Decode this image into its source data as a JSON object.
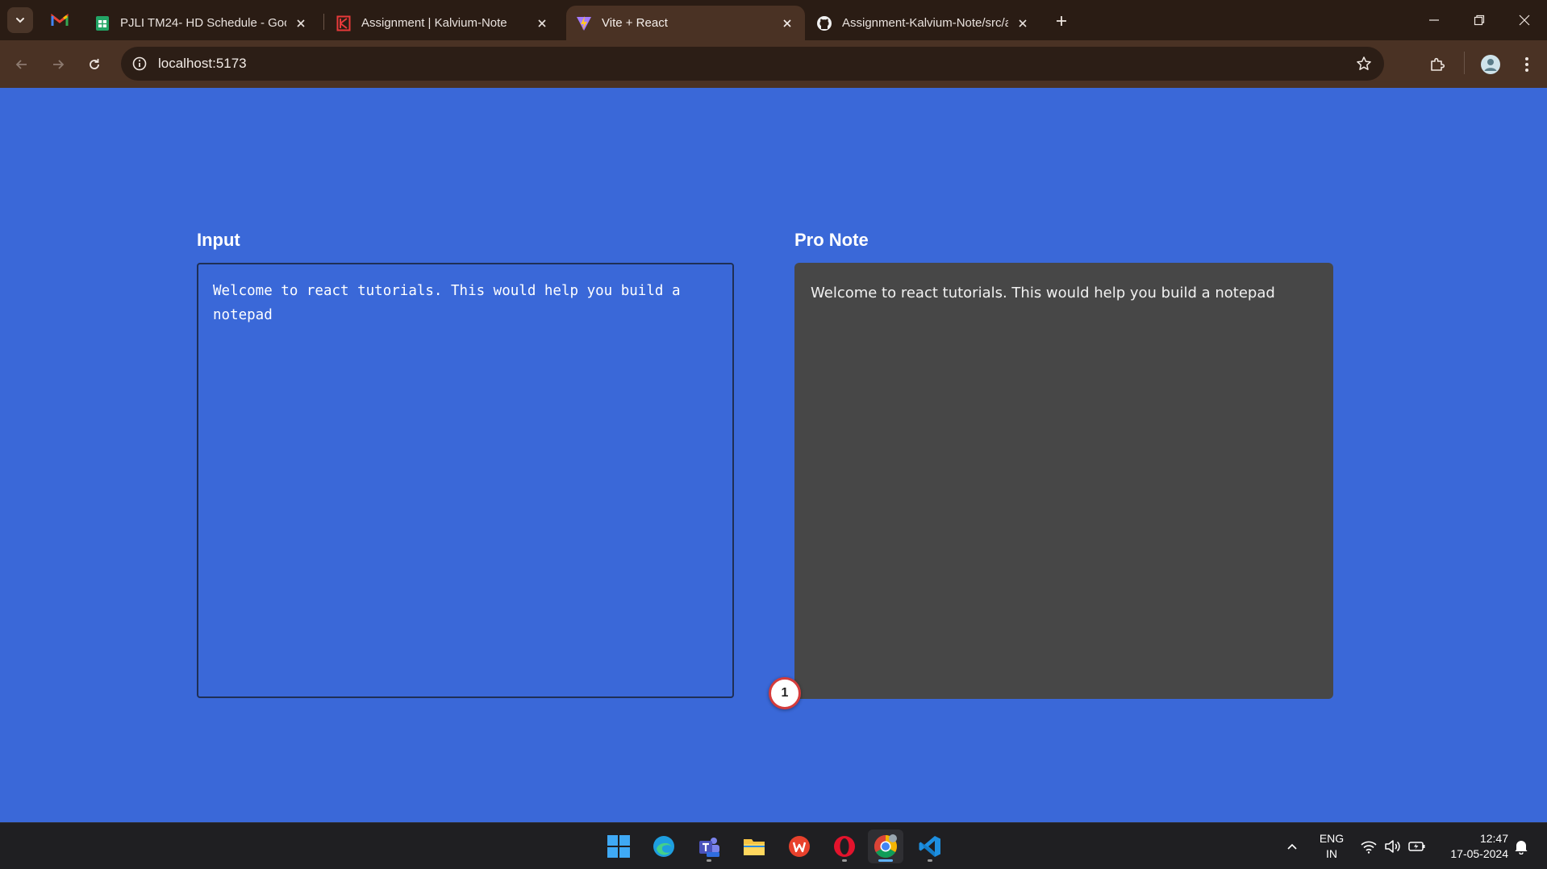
{
  "browser": {
    "tabs": [
      {
        "title": "PJLI TM24- HD Schedule - Google",
        "favicon": "google-sheets-icon",
        "active": false
      },
      {
        "title": "Assignment | Kalvium-Note",
        "favicon": "kalvium-icon",
        "active": false
      },
      {
        "title": "Vite + React",
        "favicon": "vite-icon",
        "active": true
      },
      {
        "title": "Assignment-Kalvium-Note/src/a",
        "favicon": "github-icon",
        "active": false
      }
    ],
    "pinned_tab_icon": "gmail-icon",
    "url": "localhost:5173"
  },
  "page": {
    "input_label": "Input",
    "input_text": "Welcome to react tutorials. This would help you build a notepad",
    "preview_label": "Pro Note",
    "preview_text": "Welcome to react tutorials. This would help you build a notepad",
    "badge_count": "1"
  },
  "taskbar": {
    "apps": [
      "windows-start-icon",
      "edge-icon",
      "teams-icon",
      "file-explorer-icon",
      "wps-office-icon",
      "opera-icon",
      "chrome-icon",
      "vscode-icon"
    ],
    "lang_line1": "ENG",
    "lang_line2": "IN",
    "time": "12:47",
    "date": "17-05-2024"
  },
  "colors": {
    "page_bg": "#3a68d8",
    "preview_bg": "#474747",
    "chrome_dark": "#2a1c14",
    "chrome_toolbar": "#4a3224",
    "taskbar_bg": "#1f1f22"
  }
}
